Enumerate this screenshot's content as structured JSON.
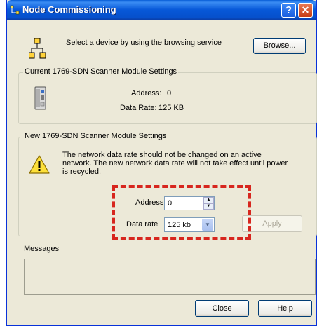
{
  "window": {
    "title": "Node Commissioning",
    "help_glyph": "?",
    "close_glyph": "✕"
  },
  "browse": {
    "instruction": "Select a device by using the browsing service",
    "button_label": "Browse..."
  },
  "current_settings": {
    "group_title": "Current 1769-SDN Scanner Module Settings",
    "address_label": "Address:",
    "address_value": "0",
    "data_rate_label": "Data Rate:",
    "data_rate_value": "125 KB"
  },
  "new_settings": {
    "group_title": "New 1769-SDN Scanner Module Settings",
    "warning_line1": "The network data rate should not be changed on an active",
    "warning_line2": "network. The new network data rate will not take effect until power",
    "warning_line3": "is recycled.",
    "address_label": "Address",
    "address_value": "0",
    "data_rate_label": "Data rate",
    "data_rate_value": "125 kb",
    "apply_label": "Apply"
  },
  "messages": {
    "label": "Messages"
  },
  "footer": {
    "close_label": "Close",
    "help_label": "Help"
  },
  "icons": {
    "title": "network-icon",
    "browse": "network-tree-icon",
    "module": "scanner-module-icon",
    "warning": "warning-icon"
  },
  "colors": {
    "highlight": "#d7261e",
    "title_bar": "#0758d8"
  }
}
